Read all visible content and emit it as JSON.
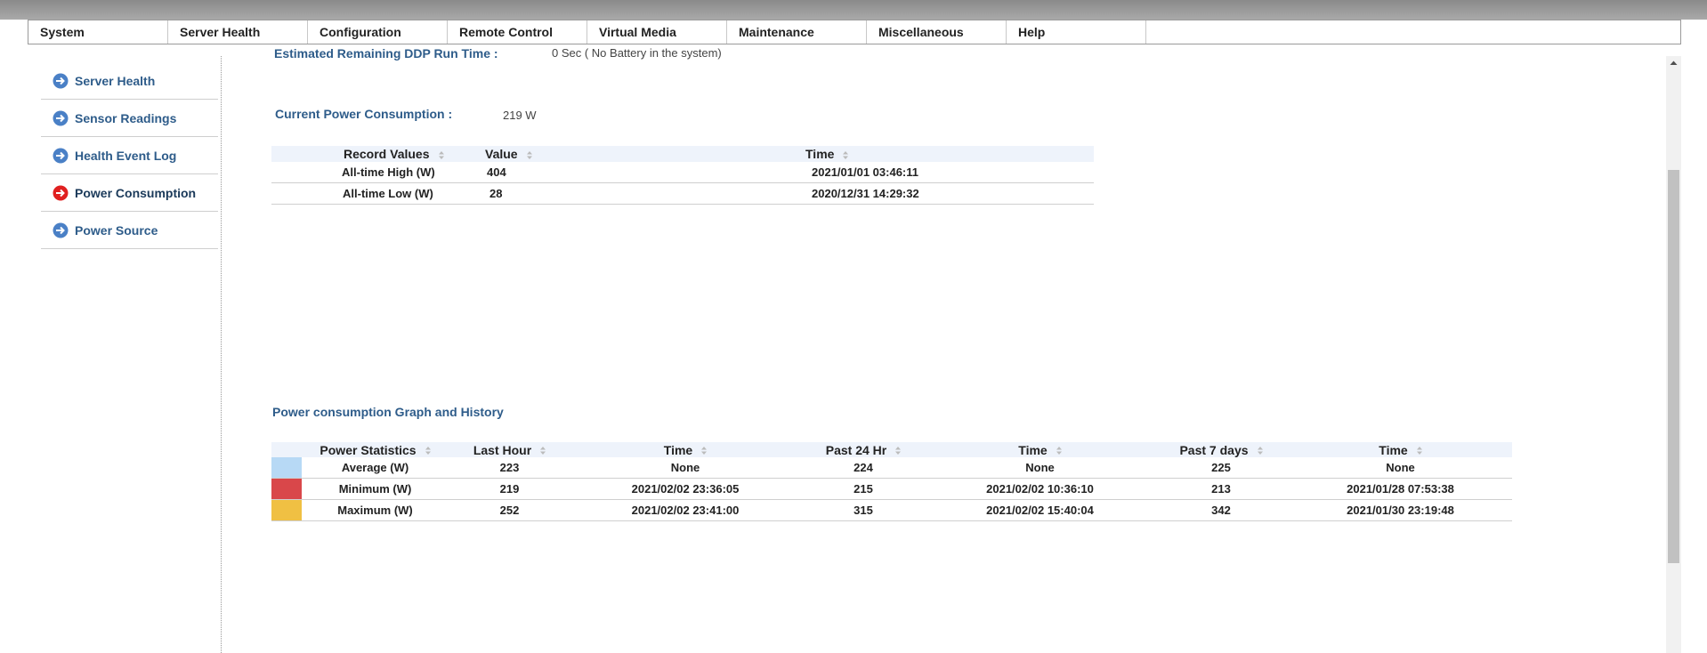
{
  "menu": [
    "System",
    "Server Health",
    "Configuration",
    "Remote Control",
    "Virtual Media",
    "Maintenance",
    "Miscellaneous",
    "Help"
  ],
  "sidebar": {
    "items": [
      {
        "label": "Server Health",
        "icon": "arrow-circle-icon",
        "active": false
      },
      {
        "label": "Sensor Readings",
        "icon": "arrow-circle-icon",
        "active": false
      },
      {
        "label": "Health Event Log",
        "icon": "arrow-circle-icon",
        "active": false
      },
      {
        "label": "Power Consumption",
        "icon": "arrow-circle-icon",
        "active": true
      },
      {
        "label": "Power Source",
        "icon": "arrow-circle-icon",
        "active": false
      }
    ],
    "icon_color": "#4a80c6",
    "active_icon_color": "#e02020"
  },
  "main": {
    "clipped_label": "Estimated Remaining DDP Run Time :",
    "clipped_value": "0 Sec ( No Battery in the system)",
    "current_power_label": "Current Power Consumption :",
    "current_power_value": "219 W",
    "records_table": {
      "headers": [
        "Record Values",
        "Value",
        "Time"
      ],
      "rows": [
        [
          "All-time High (W)",
          "404",
          "2021/01/01 03:46:11"
        ],
        [
          "All-time Low (W)",
          "28",
          "2020/12/31 14:29:32"
        ]
      ]
    },
    "graph_title": "Power consumption Graph and History",
    "stats_table": {
      "headers": [
        "Power Statistics",
        "Last Hour",
        "Time",
        "Past 24 Hr",
        "Time",
        "Past 7 days",
        "Time"
      ],
      "rows": [
        {
          "color": "#b7d9f5",
          "cells": [
            "Average (W)",
            "223",
            "None",
            "224",
            "None",
            "225",
            "None"
          ]
        },
        {
          "color": "#d9474a",
          "cells": [
            "Minimum (W)",
            "219",
            "2021/02/02 23:36:05",
            "215",
            "2021/02/02 10:36:10",
            "213",
            "2021/01/28 07:53:38"
          ]
        },
        {
          "color": "#f0c043",
          "cells": [
            "Maximum (W)",
            "252",
            "2021/02/02 23:41:00",
            "315",
            "2021/02/02 15:40:04",
            "342",
            "2021/01/30 23:19:48"
          ]
        }
      ]
    }
  }
}
